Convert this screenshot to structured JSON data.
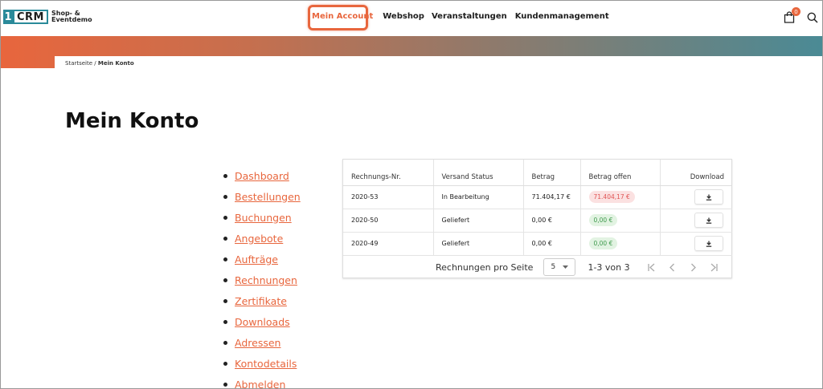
{
  "header": {
    "logo_number": "1",
    "logo_crm": "CRM",
    "logo_line1": "Shop- &",
    "logo_line2": "Eventdemo",
    "nav": [
      {
        "label": "Mein Account"
      },
      {
        "label": "Webshop"
      },
      {
        "label": "Veranstaltungen"
      },
      {
        "label": "Kundenmanagement"
      }
    ],
    "cart_count": "0",
    "cart_icon": "shopping-bag-icon",
    "search_icon": "search-icon"
  },
  "colors": {
    "accent": "#e8663d",
    "teal": "#2a8a9a"
  },
  "breadcrumb": {
    "home": "Startseite",
    "separator": " / ",
    "current": "Mein Konto"
  },
  "page_title": "Mein Konto",
  "menu": [
    {
      "label": "Dashboard"
    },
    {
      "label": "Bestellungen"
    },
    {
      "label": "Buchungen"
    },
    {
      "label": "Angebote"
    },
    {
      "label": "Aufträge"
    },
    {
      "label": "Rechnungen"
    },
    {
      "label": "Zertifikate"
    },
    {
      "label": "Downloads"
    },
    {
      "label": "Adressen"
    },
    {
      "label": "Kontodetails"
    },
    {
      "label": "Abmelden"
    }
  ],
  "table": {
    "headers": [
      "Rechnungs-Nr.",
      "Versand Status",
      "Betrag",
      "Betrag offen",
      "Download"
    ],
    "rows": [
      {
        "nr": "2020-53",
        "status": "In Bearbeitung",
        "betrag": "71.404,17 €",
        "offen": "71.404,17 €",
        "offen_state": "red"
      },
      {
        "nr": "2020-50",
        "status": "Geliefert",
        "betrag": "0,00 €",
        "offen": "0,00 €",
        "offen_state": "green"
      },
      {
        "nr": "2020-49",
        "status": "Geliefert",
        "betrag": "0,00 €",
        "offen": "0,00 €",
        "offen_state": "green"
      }
    ],
    "download_icon": "download-icon"
  },
  "pagination": {
    "label": "Rechnungen pro Seite",
    "per_page": "5",
    "range": "1-3 von 3"
  }
}
